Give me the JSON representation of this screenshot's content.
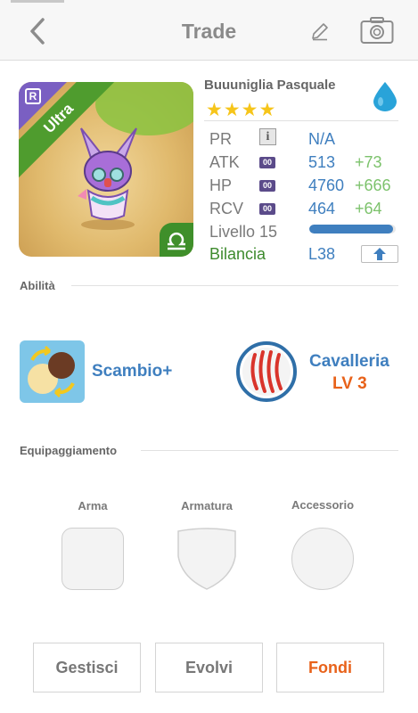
{
  "header": {
    "title": "Trade",
    "back_icon": "chevron-left-icon",
    "edit_icon": "pencil-icon",
    "camera_icon": "camera-icon"
  },
  "character": {
    "name": "Buuuniglia Pasquale",
    "rarity_tag": "Ultra",
    "rank_badge": "R",
    "stars": "★★★★",
    "element_icon": "water-drop-icon",
    "sign_icon": "libra-icon",
    "colors": {
      "ribbon": "#4f9c2e",
      "corner": "#7a5fc2",
      "water": "#29a3d9"
    }
  },
  "stats": {
    "pr": {
      "label": "PR",
      "value": "N/A",
      "badge": "i"
    },
    "atk": {
      "label": "ATK",
      "badge": "00",
      "value": "513",
      "bonus": "+73"
    },
    "hp": {
      "label": "HP",
      "badge": "00",
      "value": "4760",
      "bonus": "+666"
    },
    "rcv": {
      "label": "RCV",
      "badge": "00",
      "value": "464",
      "bonus": "+64"
    },
    "level": {
      "label": "Livello 15",
      "progress": 0.97
    },
    "sign": {
      "label": "Bilancia",
      "value": "L38",
      "button_icon": "arrow-up-icon"
    }
  },
  "abilities": {
    "section_title": "Abilità",
    "skill": {
      "name": "Scambio+",
      "icon": "swap-icon"
    },
    "trait": {
      "name": "Cavalleria",
      "level": "LV 3",
      "icon": "claw-marks-icon"
    }
  },
  "equipment": {
    "section_title": "Equipaggiamento",
    "slots": [
      {
        "label": "Arma",
        "shape": "rounded-square"
      },
      {
        "label": "Armatura",
        "shape": "shield"
      },
      {
        "label": "Accessorio",
        "shape": "circle"
      }
    ]
  },
  "actions": {
    "manage": "Gestisci",
    "evolve": "Evolvi",
    "fuse": "Fondi",
    "fuse_color": "#e8621a"
  }
}
